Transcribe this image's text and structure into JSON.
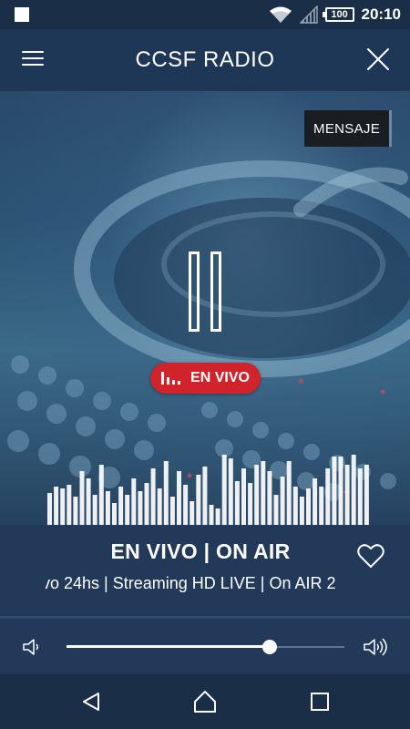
{
  "status_bar": {
    "battery": "100",
    "time": "20:10"
  },
  "header": {
    "title": "CCSF RADIO",
    "menu_icon": "hamburger-menu-icon",
    "close_icon": "close-icon"
  },
  "hero": {
    "message_button": "MENSAJE",
    "player_state_icon": "pause-icon",
    "live_badge": "EN VIVO"
  },
  "now_playing": {
    "title": "EN VIVO | ON AIR",
    "ticker": "ivo 24hs | Streaming HD LIVE | On AIR 2",
    "favorite_icon": "heart-outline-icon"
  },
  "volume": {
    "level": 0.73,
    "low_icon": "volume-low-icon",
    "high_icon": "volume-high-icon"
  },
  "equalizer": {
    "levels": [
      0.32,
      0.38,
      0.36,
      0.4,
      0.28,
      0.54,
      0.46,
      0.3,
      0.6,
      0.34,
      0.22,
      0.38,
      0.3,
      0.46,
      0.34,
      0.42,
      0.56,
      0.36,
      0.64,
      0.28,
      0.54,
      0.4,
      0.24,
      0.5,
      0.58,
      0.2,
      0.16,
      0.7,
      0.66,
      0.44,
      0.56,
      0.42,
      0.6,
      0.64,
      0.54,
      0.3,
      0.48,
      0.64,
      0.38,
      0.28,
      0.36,
      0.46,
      0.38,
      0.56,
      0.68,
      0.68,
      0.6,
      0.7,
      0.56,
      0.6
    ]
  },
  "colors": {
    "live_red": "#d0232b",
    "panel_bg": "#22395a",
    "accent_white": "#ffffff"
  }
}
